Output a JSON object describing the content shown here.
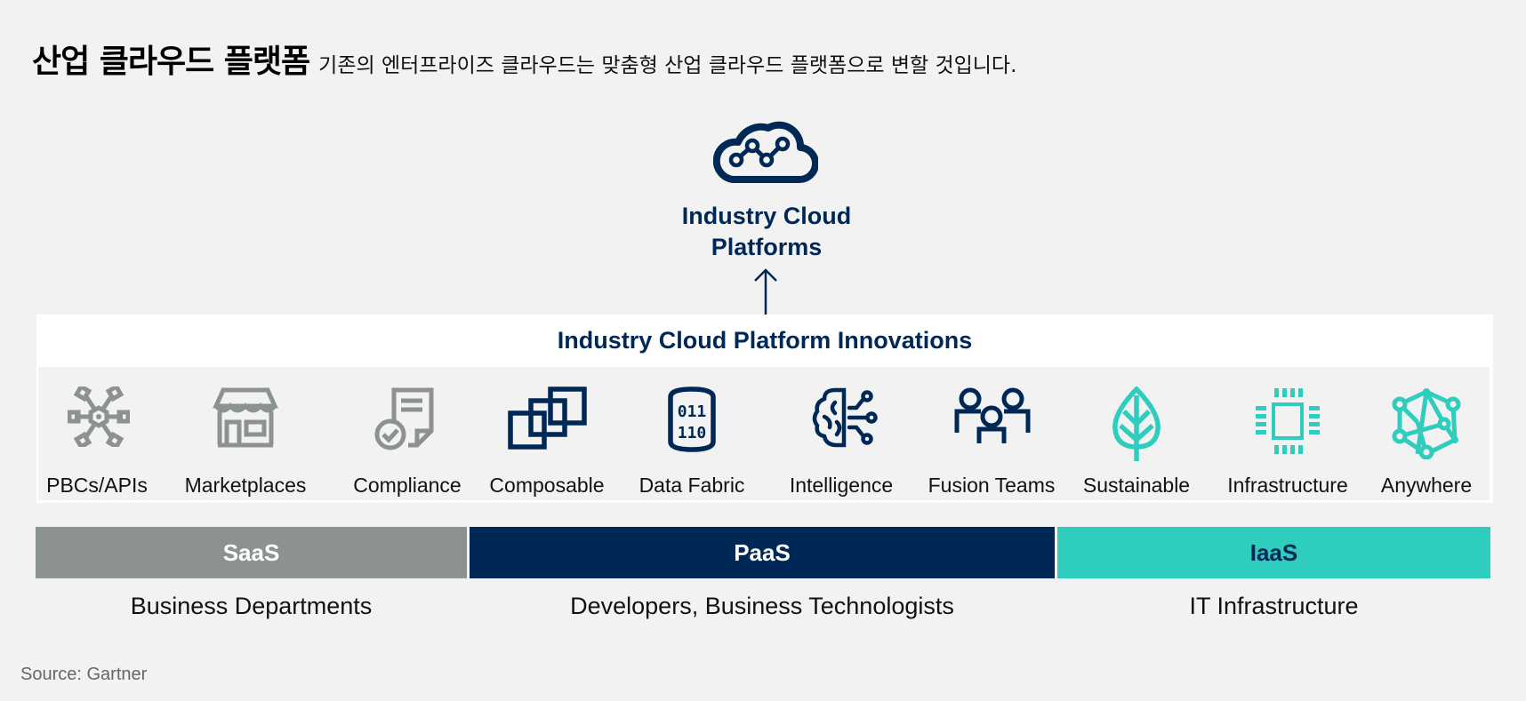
{
  "header": {
    "title": "산업 클라우드 플랫폼",
    "subtitle": "기존의 엔터프라이즈 클라우드는 맞춤형 산업 클라우드 플랫폼으로 변할 것입니다."
  },
  "top": {
    "icon": "cloud-network-icon",
    "label_line1": "Industry Cloud",
    "label_line2": "Platforms"
  },
  "innovations": {
    "heading": "Industry Cloud Platform Innovations",
    "items": [
      {
        "label": "PBCs/APIs",
        "icon": "api-hub-icon",
        "color": "#8c9191"
      },
      {
        "label": "Marketplaces",
        "icon": "storefront-icon",
        "color": "#8c9191"
      },
      {
        "label": "Compliance",
        "icon": "document-check-icon",
        "color": "#8c9191"
      },
      {
        "label": "Composable",
        "icon": "stacked-squares-icon",
        "color": "#002856"
      },
      {
        "label": "Data Fabric",
        "icon": "binary-database-icon",
        "color": "#002856"
      },
      {
        "label": "Intelligence",
        "icon": "brain-circuit-icon",
        "color": "#002856"
      },
      {
        "label": "Fusion Teams",
        "icon": "team-people-icon",
        "color": "#002856"
      },
      {
        "label": "Sustainable",
        "icon": "leaf-icon",
        "color": "#2ecdbd"
      },
      {
        "label": "Infrastructure",
        "icon": "chip-icon",
        "color": "#2ecdbd"
      },
      {
        "label": "Anywhere",
        "icon": "mesh-network-icon",
        "color": "#2ecdbd"
      }
    ]
  },
  "tiers": [
    {
      "label": "SaaS",
      "audience": "Business Departments",
      "color": "#8c9191"
    },
    {
      "label": "PaaS",
      "audience": "Developers, Business Technologists",
      "color": "#002856"
    },
    {
      "label": "IaaS",
      "audience": "IT Infrastructure",
      "color": "#2ecdbd"
    }
  ],
  "footer": {
    "source": "Source: Gartner"
  },
  "colors": {
    "navy": "#002856",
    "gray": "#8c9191",
    "teal": "#2ecdbd",
    "background": "#f2f2f2"
  }
}
